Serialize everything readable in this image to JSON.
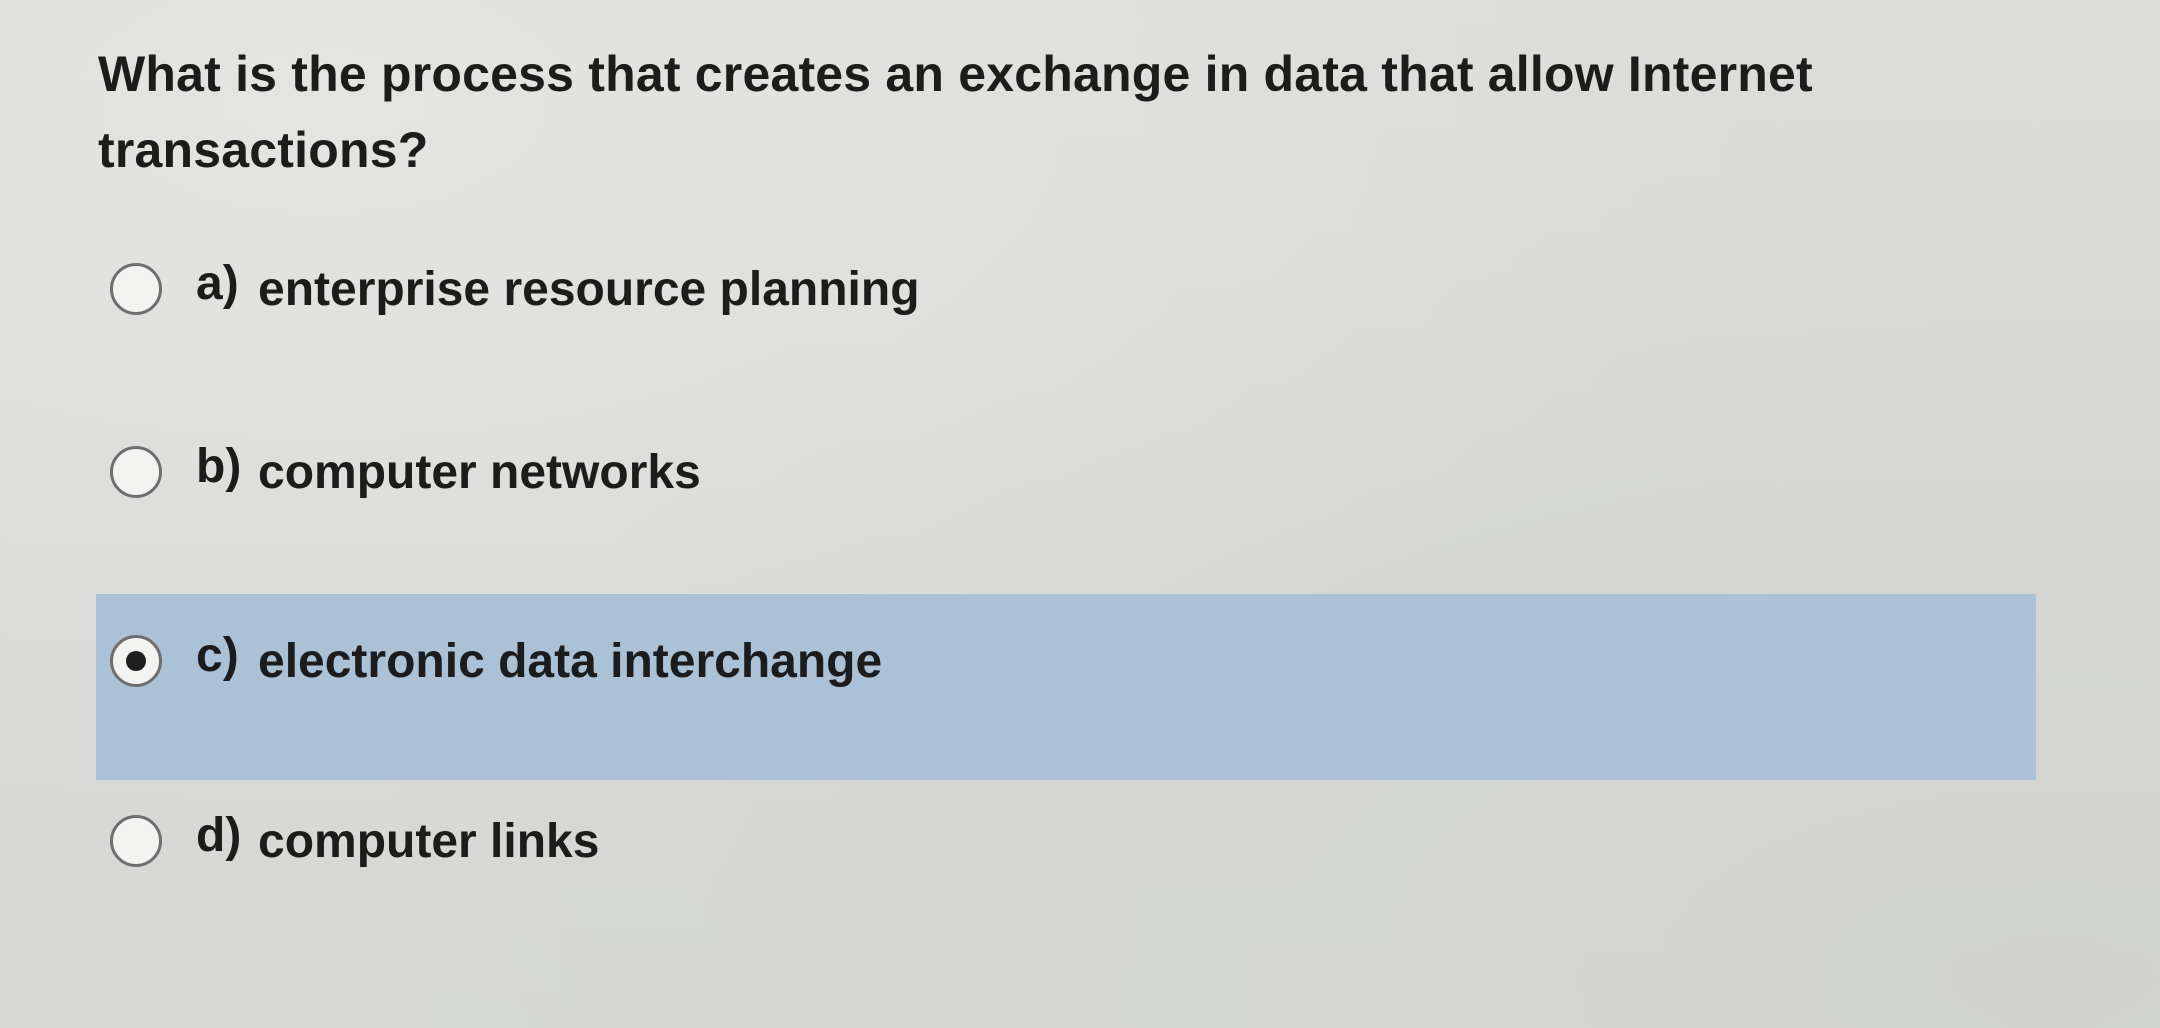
{
  "question": {
    "text": "What is the process that creates an exchange in data that allow Internet transactions?"
  },
  "options": [
    {
      "letter": "a)",
      "label": "enterprise resource planning",
      "selected": false
    },
    {
      "letter": "b)",
      "label": "computer networks",
      "selected": false
    },
    {
      "letter": "c)",
      "label": "electronic data interchange",
      "selected": true
    },
    {
      "letter": "d)",
      "label": "computer links",
      "selected": false
    }
  ],
  "colors": {
    "selected_row_background": "#aac1d6",
    "page_background": "#dcdcda",
    "text": "#1c1c1c",
    "radio_border": "#6d6e70"
  }
}
